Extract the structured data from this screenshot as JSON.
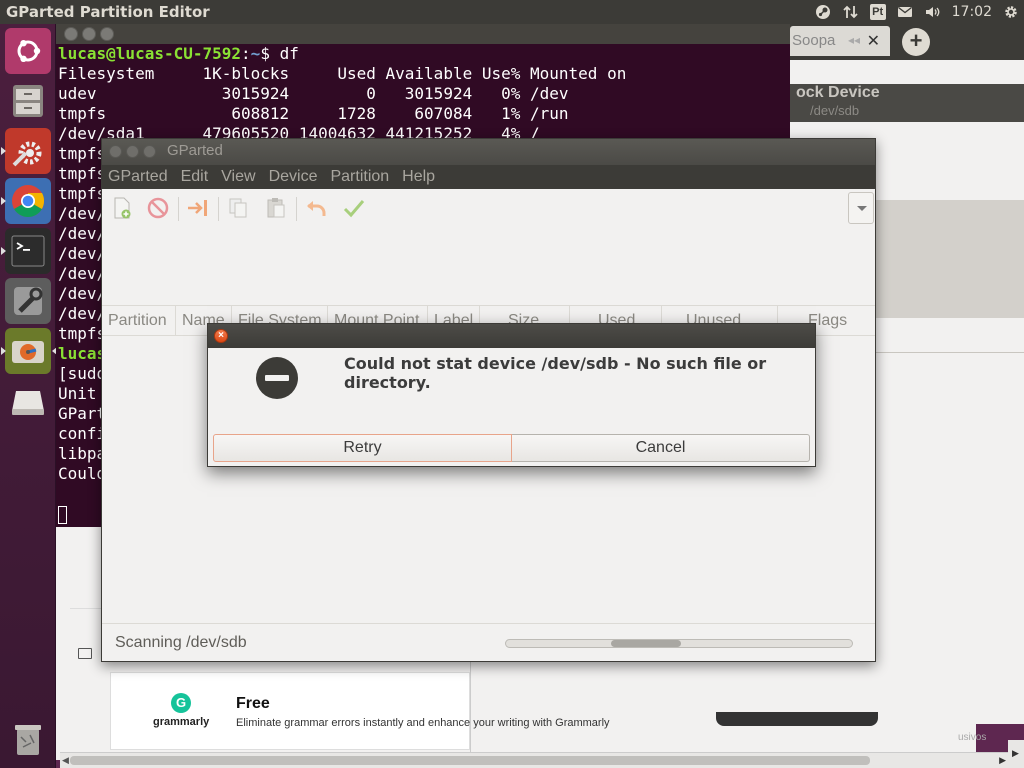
{
  "top_panel": {
    "app_title": "GParted Partition Editor",
    "keyboard_layout": "Pt",
    "clock": "17:02",
    "icons": [
      "steam-icon",
      "network-icon",
      "keyboard-icon",
      "mail-icon",
      "volume-icon",
      "gear-icon"
    ]
  },
  "launcher": {
    "items": [
      "ubuntu-dash",
      "files",
      "system-settings",
      "chrome",
      "terminal",
      "disks",
      "gparted",
      "removable-drive",
      "trash"
    ]
  },
  "terminal": {
    "prompt_user": "lucas@lucas-CU-7592",
    "prompt_path": "~",
    "prompt_symbol": "$ ",
    "command": "df",
    "lines": [
      "Filesystem     1K-blocks     Used Available Use% Mounted on",
      "udev             3015924        0   3015924   0% /dev",
      "tmpfs             608812     1728    607084   1% /run",
      "/dev/sda1      479605520 14004632 441215252   4% /",
      "tmpfs",
      "tmpfs",
      "tmpfs",
      "/dev/",
      "/dev/",
      "/dev/",
      "/dev/",
      "/dev/",
      "/dev/",
      "tmpfs",
      "lucas",
      "[sudo",
      "Unit ",
      "GPart",
      "confi",
      "libpa",
      "Could"
    ]
  },
  "background_browser": {
    "tab_label": "Soopa",
    "header_title": "ock Device",
    "header_subtitle": "/dev/sdb"
  },
  "grammarly_ad": {
    "brand": "grammarly",
    "headline": "Free",
    "description": "Eliminate grammar errors instantly and enhance your writing with Grammarly"
  },
  "bottom_right_text": "usivos",
  "gparted": {
    "window_title": "GParted",
    "menu": [
      "GParted",
      "Edit",
      "View",
      "Device",
      "Partition",
      "Help"
    ],
    "toolbar": [
      "new-partition-icon",
      "delete-icon",
      "resize-move-icon",
      "copy-icon",
      "paste-icon",
      "undo-icon",
      "apply-icon"
    ],
    "columns": [
      "Partition",
      "Name",
      "File System",
      "Mount Point",
      "Label",
      "Size",
      "Used",
      "Unused",
      "Flags"
    ],
    "status_text": "Scanning /dev/sdb"
  },
  "dialog": {
    "message": "Could not stat device /dev/sdb - No such file or directory.",
    "retry_label": "Retry",
    "cancel_label": "Cancel"
  }
}
